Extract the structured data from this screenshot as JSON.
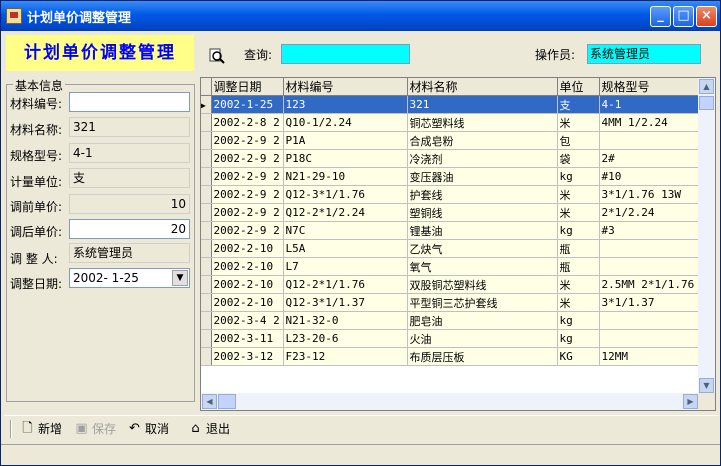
{
  "window": {
    "title": "计划单价调整管理"
  },
  "header": {
    "banner": "计划单价调整管理",
    "query_label": "查询:",
    "query_value": "",
    "operator_label": "操作员:",
    "operator_value": "系统管理员"
  },
  "form": {
    "group_title": "基本信息",
    "fields": [
      {
        "label": "材料编号:",
        "value": ""
      },
      {
        "label": "材料名称:",
        "value": "321"
      },
      {
        "label": "规格型号:",
        "value": "4-1"
      },
      {
        "label": "计量单位:",
        "value": "支"
      },
      {
        "label": "调前单价:",
        "value": "10"
      },
      {
        "label": "调后单价:",
        "value": "20"
      },
      {
        "label": "调 整 人:",
        "value": "系统管理员"
      },
      {
        "label": "调整日期:",
        "value": "2002- 1-25"
      }
    ]
  },
  "grid": {
    "columns": [
      "调整日期",
      "材料编号",
      "材料名称",
      "单位",
      "规格型号"
    ],
    "rows": [
      [
        "2002-1-25",
        "123",
        "321",
        "支",
        "4-1"
      ],
      [
        "2002-2-8 2",
        "Q10-1/2.24",
        "铜芯塑料线",
        "米",
        "4MM 1/2.24"
      ],
      [
        "2002-2-9 2",
        "P1A",
        "合成皂粉",
        "包",
        ""
      ],
      [
        "2002-2-9 2",
        "P18C",
        "冷浇剂",
        "袋",
        "2#"
      ],
      [
        "2002-2-9 2",
        "N21-29-10",
        "变压器油",
        "kg",
        "#10"
      ],
      [
        "2002-2-9 2",
        "Q12-3*1/1.76",
        "护套线",
        "米",
        "3*1/1.76 13W"
      ],
      [
        "2002-2-9 2",
        "Q12-2*1/2.24",
        "塑铜线",
        "米",
        "2*1/2.24"
      ],
      [
        "2002-2-9 2",
        "N7C",
        "锂基油",
        "kg",
        "#3"
      ],
      [
        "2002-2-10",
        "L5A",
        "乙炔气",
        "瓶",
        ""
      ],
      [
        "2002-2-10",
        "L7",
        "氧气",
        "瓶",
        ""
      ],
      [
        "2002-2-10",
        "Q12-2*1/1.76",
        "双股铜芯塑料线",
        "米",
        "2.5MM 2*1/1.76"
      ],
      [
        "2002-2-10",
        "Q12-3*1/1.37",
        "平型铜三芯护套线",
        "米",
        "3*1/1.37"
      ],
      [
        "2002-3-4 2",
        "N21-32-0",
        "肥皂油",
        "kg",
        ""
      ],
      [
        "2002-3-11",
        "L23-20-6",
        "火油",
        "kg",
        ""
      ],
      [
        "2002-3-12",
        "F23-12",
        "布质层压板",
        "KG",
        "12MM"
      ]
    ],
    "selected_row": 0
  },
  "toolbar": {
    "new_label": "新增",
    "save_label": "保存",
    "cancel_label": "取消",
    "exit_label": "退出"
  }
}
